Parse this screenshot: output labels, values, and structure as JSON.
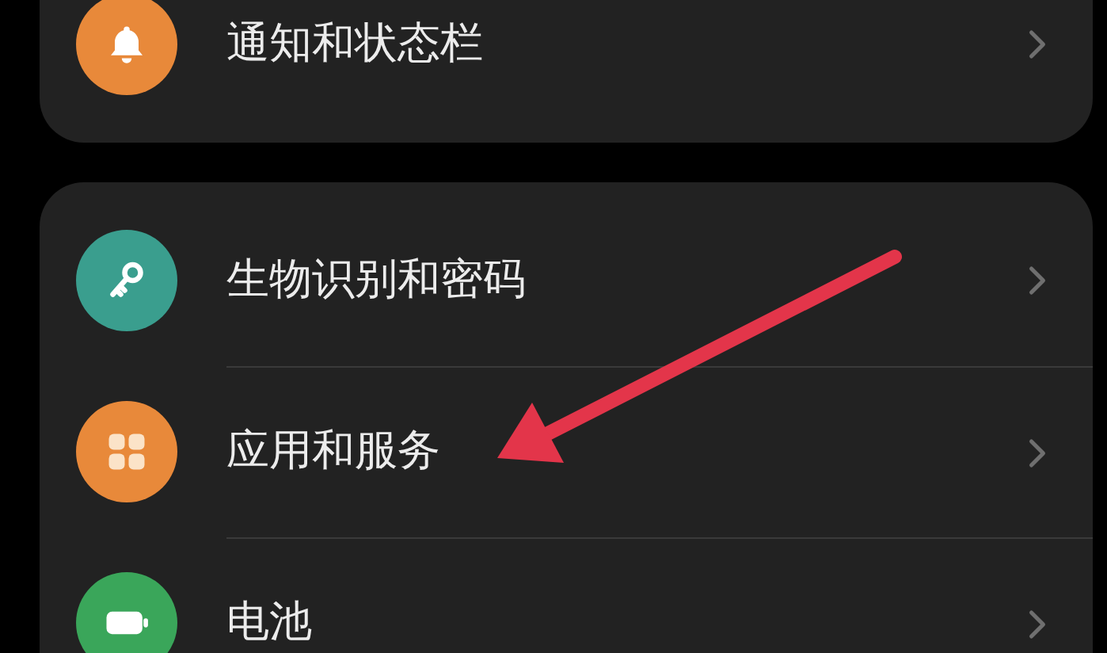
{
  "sections": [
    {
      "items": [
        {
          "label": "通知和状态栏",
          "kind": "bell",
          "color": "#e8893a"
        }
      ]
    },
    {
      "items": [
        {
          "label": "生物识别和密码",
          "kind": "key",
          "color": "#3a9e8e"
        },
        {
          "label": "应用和服务",
          "kind": "apps",
          "color": "#e8893a"
        },
        {
          "label": "电池",
          "kind": "battery",
          "color": "#3aa65a"
        }
      ]
    }
  ]
}
